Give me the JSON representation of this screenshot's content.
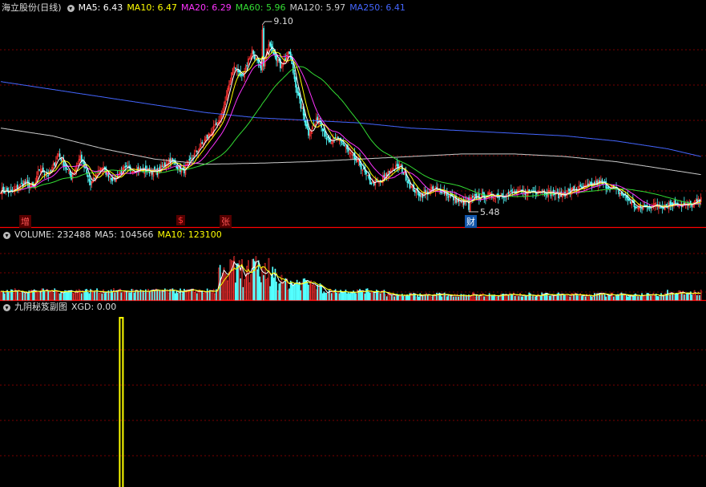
{
  "price_panel": {
    "title": "海立股份(日线)",
    "indicators": [
      {
        "label": "MA5: 6.43",
        "color": "#ffffff"
      },
      {
        "label": "MA10: 6.47",
        "color": "#ffff00"
      },
      {
        "label": "MA20: 6.29",
        "color": "#ff33ff"
      },
      {
        "label": "MA60: 5.96",
        "color": "#33dd33"
      },
      {
        "label": "MA120: 5.97",
        "color": "#cccccc"
      },
      {
        "label": "MA250: 6.41",
        "color": "#4466ff"
      }
    ],
    "high_label": "9.10",
    "low_label": "5.48",
    "markers": [
      {
        "text": "增",
        "color": "#ff5555",
        "bg": "#550000"
      },
      {
        "text": "$",
        "color": "#ff3333",
        "bg": "#550000"
      },
      {
        "text": "张",
        "color": "#ff5555",
        "bg": "#550000"
      },
      {
        "text": "财",
        "color": "#ffffff",
        "bg": "#1155aa"
      }
    ]
  },
  "volume_panel": {
    "label": "VOLUME: 232488",
    "ma5": "MA5: 104566",
    "ma10": "MA10: 123100"
  },
  "indicator_panel": {
    "title": "九阴秘笈副图",
    "value": "XGD: 0.00"
  },
  "colors": {
    "up": "#ff3333",
    "down": "#54ffff",
    "grid": "#7a0000",
    "separator": "#ff0000"
  },
  "chart_data": {
    "type": "candlestick",
    "ylim": [
      5.2,
      9.3
    ],
    "pivots_close": [
      [
        0,
        5.9
      ],
      [
        8,
        5.85
      ],
      [
        18,
        6.05
      ],
      [
        26,
        5.95
      ],
      [
        30,
        6.3
      ],
      [
        38,
        6.2
      ],
      [
        45,
        6.6
      ],
      [
        55,
        6.15
      ],
      [
        62,
        6.55
      ],
      [
        70,
        6.0
      ],
      [
        78,
        6.35
      ],
      [
        88,
        6.1
      ],
      [
        96,
        6.3
      ],
      [
        108,
        6.3
      ],
      [
        122,
        6.25
      ],
      [
        132,
        6.5
      ],
      [
        142,
        6.25
      ],
      [
        150,
        6.55
      ],
      [
        160,
        6.9
      ],
      [
        170,
        7.2
      ],
      [
        176,
        7.7
      ],
      [
        181,
        8.3
      ],
      [
        188,
        8.1
      ],
      [
        196,
        8.6
      ],
      [
        203,
        8.2
      ],
      [
        210,
        8.75
      ],
      [
        218,
        8.3
      ],
      [
        225,
        8.55
      ],
      [
        232,
        7.7
      ],
      [
        240,
        7.0
      ],
      [
        248,
        7.3
      ],
      [
        256,
        6.8
      ],
      [
        264,
        6.9
      ],
      [
        272,
        6.6
      ],
      [
        280,
        6.4
      ],
      [
        288,
        6.05
      ],
      [
        296,
        6.05
      ],
      [
        304,
        6.3
      ],
      [
        312,
        6.35
      ],
      [
        320,
        5.95
      ],
      [
        328,
        5.8
      ],
      [
        336,
        5.9
      ],
      [
        344,
        5.9
      ],
      [
        352,
        5.75
      ],
      [
        360,
        5.65
      ],
      [
        370,
        5.75
      ],
      [
        380,
        5.8
      ],
      [
        390,
        5.8
      ],
      [
        400,
        5.85
      ],
      [
        410,
        5.85
      ],
      [
        420,
        5.9
      ],
      [
        428,
        5.85
      ],
      [
        436,
        5.8
      ],
      [
        446,
        5.9
      ],
      [
        456,
        5.95
      ],
      [
        466,
        6.05
      ],
      [
        476,
        5.95
      ],
      [
        486,
        5.8
      ],
      [
        496,
        5.55
      ],
      [
        506,
        5.6
      ],
      [
        516,
        5.6
      ],
      [
        526,
        5.65
      ],
      [
        536,
        5.6
      ],
      [
        546,
        5.7
      ]
    ],
    "ma_series": [
      {
        "name": "MA120",
        "color": "#cccccc",
        "points": [
          [
            0,
            7.1
          ],
          [
            40,
            6.95
          ],
          [
            80,
            6.7
          ],
          [
            120,
            6.5
          ],
          [
            160,
            6.4
          ],
          [
            200,
            6.42
          ],
          [
            240,
            6.45
          ],
          [
            280,
            6.5
          ],
          [
            320,
            6.55
          ],
          [
            360,
            6.6
          ],
          [
            400,
            6.6
          ],
          [
            440,
            6.55
          ],
          [
            480,
            6.45
          ],
          [
            520,
            6.3
          ],
          [
            546,
            6.2
          ]
        ]
      },
      {
        "name": "MA250",
        "color": "#4466ff",
        "points": [
          [
            0,
            8.0
          ],
          [
            40,
            7.85
          ],
          [
            80,
            7.7
          ],
          [
            120,
            7.55
          ],
          [
            160,
            7.4
          ],
          [
            200,
            7.3
          ],
          [
            240,
            7.25
          ],
          [
            280,
            7.2
          ],
          [
            320,
            7.1
          ],
          [
            360,
            7.05
          ],
          [
            400,
            7.0
          ],
          [
            440,
            6.95
          ],
          [
            480,
            6.85
          ],
          [
            520,
            6.7
          ],
          [
            546,
            6.55
          ]
        ]
      }
    ],
    "events": [
      {
        "label": "9.10",
        "bar": 204,
        "value": 9.1
      },
      {
        "label": "5.48",
        "bar": 365,
        "value": 5.48
      }
    ],
    "volume": {
      "ylim": [
        0,
        600000
      ],
      "last": 232488,
      "ma5": 104566,
      "ma10": 123100
    },
    "xgd_signal": {
      "bar": 94,
      "value": 1
    }
  }
}
